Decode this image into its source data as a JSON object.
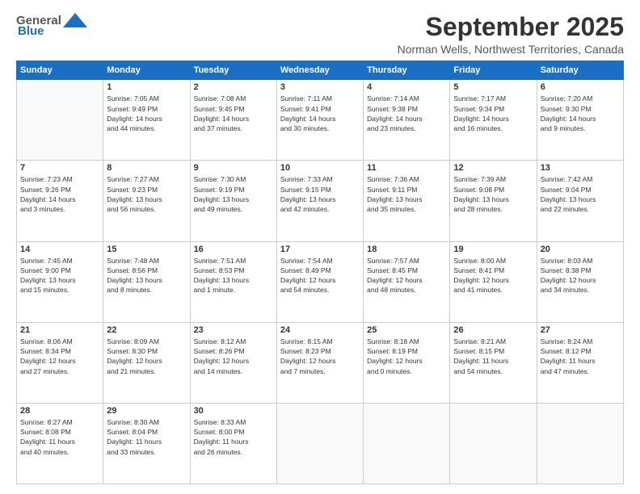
{
  "logo": {
    "general": "General",
    "blue": "Blue"
  },
  "title": "September 2025",
  "location": "Norman Wells, Northwest Territories, Canada",
  "days_of_week": [
    "Sunday",
    "Monday",
    "Tuesday",
    "Wednesday",
    "Thursday",
    "Friday",
    "Saturday"
  ],
  "weeks": [
    [
      {
        "day": "",
        "info": ""
      },
      {
        "day": "1",
        "info": "Sunrise: 7:05 AM\nSunset: 9:49 PM\nDaylight: 14 hours\nand 44 minutes."
      },
      {
        "day": "2",
        "info": "Sunrise: 7:08 AM\nSunset: 9:45 PM\nDaylight: 14 hours\nand 37 minutes."
      },
      {
        "day": "3",
        "info": "Sunrise: 7:11 AM\nSunset: 9:41 PM\nDaylight: 14 hours\nand 30 minutes."
      },
      {
        "day": "4",
        "info": "Sunrise: 7:14 AM\nSunset: 9:38 PM\nDaylight: 14 hours\nand 23 minutes."
      },
      {
        "day": "5",
        "info": "Sunrise: 7:17 AM\nSunset: 9:34 PM\nDaylight: 14 hours\nand 16 minutes."
      },
      {
        "day": "6",
        "info": "Sunrise: 7:20 AM\nSunset: 9:30 PM\nDaylight: 14 hours\nand 9 minutes."
      }
    ],
    [
      {
        "day": "7",
        "info": "Sunrise: 7:23 AM\nSunset: 9:26 PM\nDaylight: 14 hours\nand 3 minutes."
      },
      {
        "day": "8",
        "info": "Sunrise: 7:27 AM\nSunset: 9:23 PM\nDaylight: 13 hours\nand 56 minutes."
      },
      {
        "day": "9",
        "info": "Sunrise: 7:30 AM\nSunset: 9:19 PM\nDaylight: 13 hours\nand 49 minutes."
      },
      {
        "day": "10",
        "info": "Sunrise: 7:33 AM\nSunset: 9:15 PM\nDaylight: 13 hours\nand 42 minutes."
      },
      {
        "day": "11",
        "info": "Sunrise: 7:36 AM\nSunset: 9:11 PM\nDaylight: 13 hours\nand 35 minutes."
      },
      {
        "day": "12",
        "info": "Sunrise: 7:39 AM\nSunset: 9:08 PM\nDaylight: 13 hours\nand 28 minutes."
      },
      {
        "day": "13",
        "info": "Sunrise: 7:42 AM\nSunset: 9:04 PM\nDaylight: 13 hours\nand 22 minutes."
      }
    ],
    [
      {
        "day": "14",
        "info": "Sunrise: 7:45 AM\nSunset: 9:00 PM\nDaylight: 13 hours\nand 15 minutes."
      },
      {
        "day": "15",
        "info": "Sunrise: 7:48 AM\nSunset: 8:56 PM\nDaylight: 13 hours\nand 8 minutes."
      },
      {
        "day": "16",
        "info": "Sunrise: 7:51 AM\nSunset: 8:53 PM\nDaylight: 13 hours\nand 1 minute."
      },
      {
        "day": "17",
        "info": "Sunrise: 7:54 AM\nSunset: 8:49 PM\nDaylight: 12 hours\nand 54 minutes."
      },
      {
        "day": "18",
        "info": "Sunrise: 7:57 AM\nSunset: 8:45 PM\nDaylight: 12 hours\nand 48 minutes."
      },
      {
        "day": "19",
        "info": "Sunrise: 8:00 AM\nSunset: 8:41 PM\nDaylight: 12 hours\nand 41 minutes."
      },
      {
        "day": "20",
        "info": "Sunrise: 8:03 AM\nSunset: 8:38 PM\nDaylight: 12 hours\nand 34 minutes."
      }
    ],
    [
      {
        "day": "21",
        "info": "Sunrise: 8:06 AM\nSunset: 8:34 PM\nDaylight: 12 hours\nand 27 minutes."
      },
      {
        "day": "22",
        "info": "Sunrise: 8:09 AM\nSunset: 8:30 PM\nDaylight: 12 hours\nand 21 minutes."
      },
      {
        "day": "23",
        "info": "Sunrise: 8:12 AM\nSunset: 8:26 PM\nDaylight: 12 hours\nand 14 minutes."
      },
      {
        "day": "24",
        "info": "Sunrise: 8:15 AM\nSunset: 8:23 PM\nDaylight: 12 hours\nand 7 minutes."
      },
      {
        "day": "25",
        "info": "Sunrise: 8:18 AM\nSunset: 8:19 PM\nDaylight: 12 hours\nand 0 minutes."
      },
      {
        "day": "26",
        "info": "Sunrise: 8:21 AM\nSunset: 8:15 PM\nDaylight: 11 hours\nand 54 minutes."
      },
      {
        "day": "27",
        "info": "Sunrise: 8:24 AM\nSunset: 8:12 PM\nDaylight: 11 hours\nand 47 minutes."
      }
    ],
    [
      {
        "day": "28",
        "info": "Sunrise: 8:27 AM\nSunset: 8:08 PM\nDaylight: 11 hours\nand 40 minutes."
      },
      {
        "day": "29",
        "info": "Sunrise: 8:30 AM\nSunset: 8:04 PM\nDaylight: 11 hours\nand 33 minutes."
      },
      {
        "day": "30",
        "info": "Sunrise: 8:33 AM\nSunset: 8:00 PM\nDaylight: 11 hours\nand 26 minutes."
      },
      {
        "day": "",
        "info": ""
      },
      {
        "day": "",
        "info": ""
      },
      {
        "day": "",
        "info": ""
      },
      {
        "day": "",
        "info": ""
      }
    ]
  ]
}
